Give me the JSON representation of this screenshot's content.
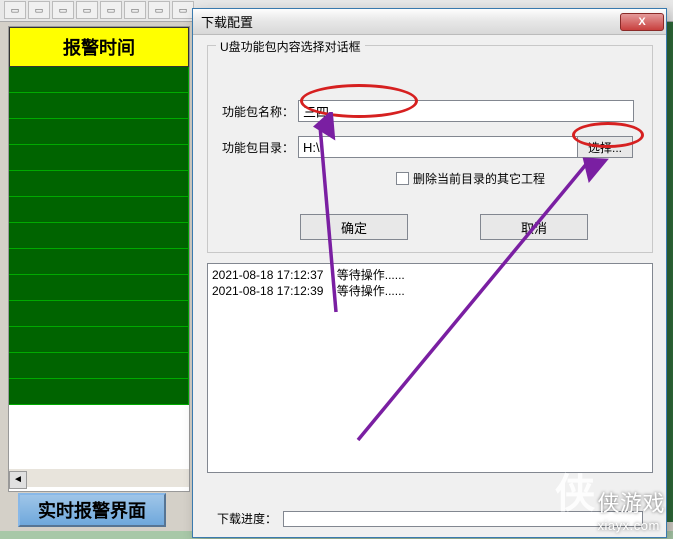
{
  "toolbar_icons": [
    "▭",
    "▭",
    "▭",
    "▭",
    "▭",
    "▭",
    "▭",
    "▭",
    "▭",
    "▭",
    "▭",
    "▭",
    "▭",
    "▭",
    "▭",
    "▭",
    "▭",
    "▭",
    "▭",
    "▭"
  ],
  "left": {
    "header": "报警时间",
    "realtime_btn": "实时报警界面"
  },
  "dialog": {
    "title": "下载配置",
    "close": "X",
    "group_title": "U盘功能包内容选择对话框",
    "name_label": "功能包名称：",
    "name_value": "三四",
    "dir_label": "功能包目录：",
    "dir_value": "H:\\",
    "browse_btn": "选择...",
    "checkbox_label": "删除当前目录的其它工程",
    "ok_btn": "确定",
    "cancel_btn": "取消",
    "log_line1": "2021-08-18 17:12:37    等待操作......",
    "log_line2": "2021-08-18 17:12:39    等待操作......",
    "progress_label": "下载进度："
  },
  "watermark": {
    "text": "xiayx.com",
    "brand": "侠游戏"
  }
}
